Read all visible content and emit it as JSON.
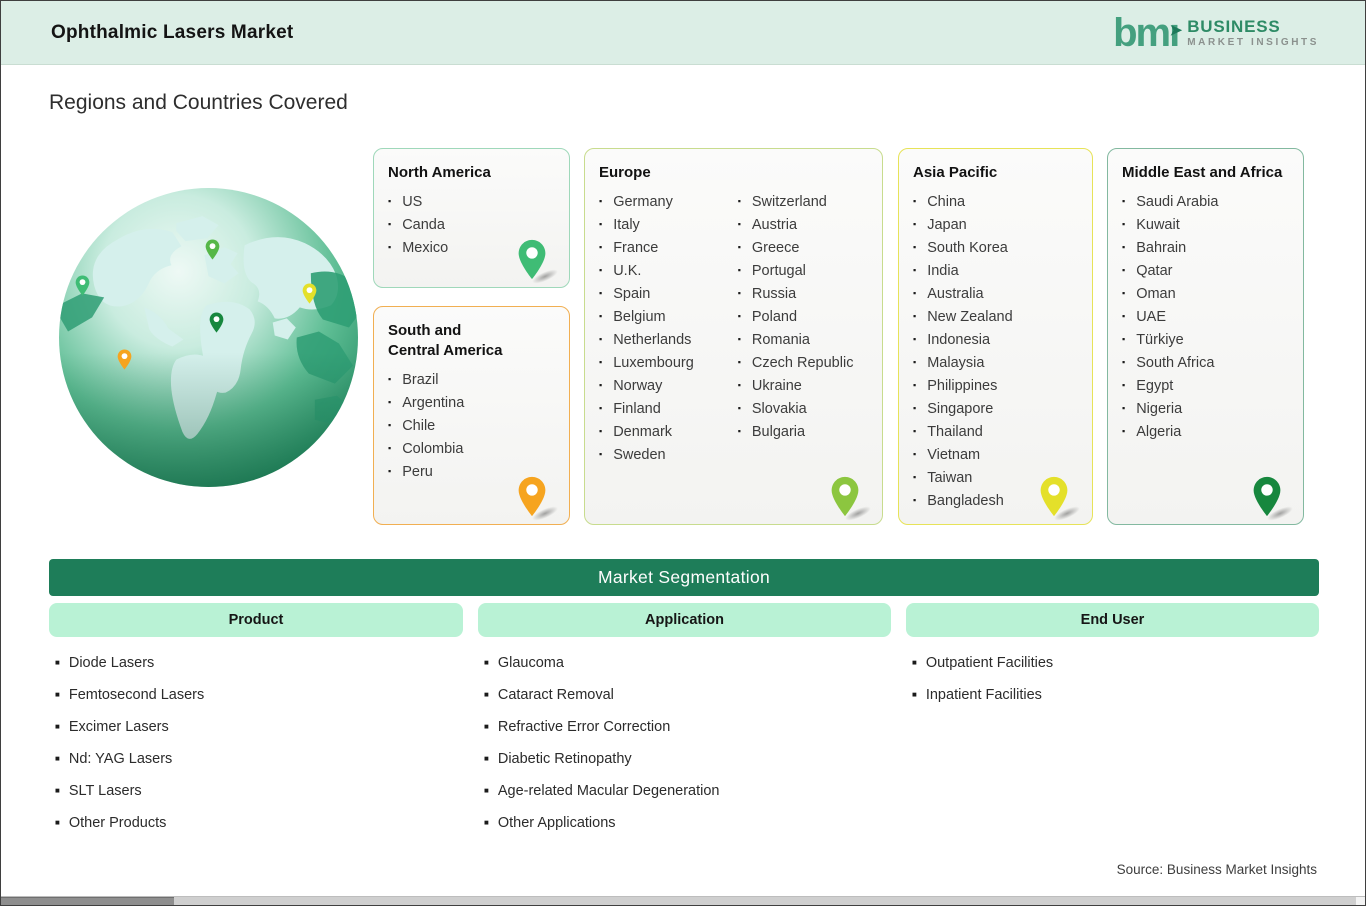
{
  "header": {
    "title": "Ophthalmic Lasers Market",
    "logo": {
      "mark": "bmı",
      "arrow": "➤",
      "line1": "BUSINESS",
      "line2": "MARKET INSIGHTS"
    }
  },
  "section_title": "Regions and Countries Covered",
  "regions": [
    {
      "title": "North America",
      "items": [
        "US",
        "Canda",
        "Mexico"
      ]
    },
    {
      "title_line1": "South and",
      "title_line2": "Central America",
      "items": [
        "Brazil",
        "Argentina",
        "Chile",
        "Colombia",
        "Peru"
      ]
    },
    {
      "title": "Europe",
      "items_left": [
        "Germany",
        "Italy",
        "France",
        "U.K.",
        "Spain",
        "Belgium",
        "Netherlands",
        "Luxembourg",
        "Norway",
        "Finland",
        "Denmark",
        "Sweden"
      ],
      "items_right": [
        "Switzerland",
        "Austria",
        "Greece",
        "Portugal",
        "Russia",
        "Poland",
        "Romania",
        "Czech Republic",
        "Ukraine",
        "Slovakia",
        "Bulgaria"
      ]
    },
    {
      "title": "Asia Pacific",
      "items": [
        "China",
        "Japan",
        "South Korea",
        "India",
        "Australia",
        "New Zealand",
        "Indonesia",
        "Malaysia",
        "Philippines",
        "Singapore",
        "Thailand",
        "Vietnam",
        "Taiwan",
        "Bangladesh"
      ]
    },
    {
      "title": "Middle East and Africa",
      "items": [
        "Saudi Arabia",
        "Kuwait",
        "Bahrain",
        "Qatar",
        "Oman",
        "UAE",
        "Türkiye",
        "South Africa",
        "Egypt",
        "Nigeria",
        "Algeria"
      ]
    }
  ],
  "segmentation": {
    "title": "Market Segmentation",
    "columns": [
      {
        "header": "Product",
        "items": [
          "Diode Lasers",
          "Femtosecond Lasers",
          "Excimer Lasers",
          "Nd: YAG Lasers",
          "SLT Lasers",
          "Other Products"
        ]
      },
      {
        "header": "Application",
        "items": [
          "Glaucoma",
          "Cataract Removal",
          "Refractive Error Correction",
          "Diabetic Retinopathy",
          "Age-related Macular Degeneration",
          "Other Applications"
        ]
      },
      {
        "header": "End User",
        "items": [
          "Outpatient Facilities",
          "Inpatient Facilities"
        ]
      }
    ]
  },
  "source": "Source: Business Market Insights",
  "colors": {
    "header-bg": "#dceee6",
    "banner-green": "#1e7d59",
    "mint": "#b9f2d5",
    "na-accent": "#9fd8ba",
    "na-pin": "#3fbc75",
    "sca-accent": "#f1af52",
    "sca-pin": "#f6a41f",
    "eu-accent": "#c8dc8e",
    "eu-pin": "#8cc63f",
    "ap-accent": "#e7e359",
    "ap-pin": "#e4e02a",
    "mea-accent": "#83b9a0",
    "mea-pin": "#17873e"
  }
}
